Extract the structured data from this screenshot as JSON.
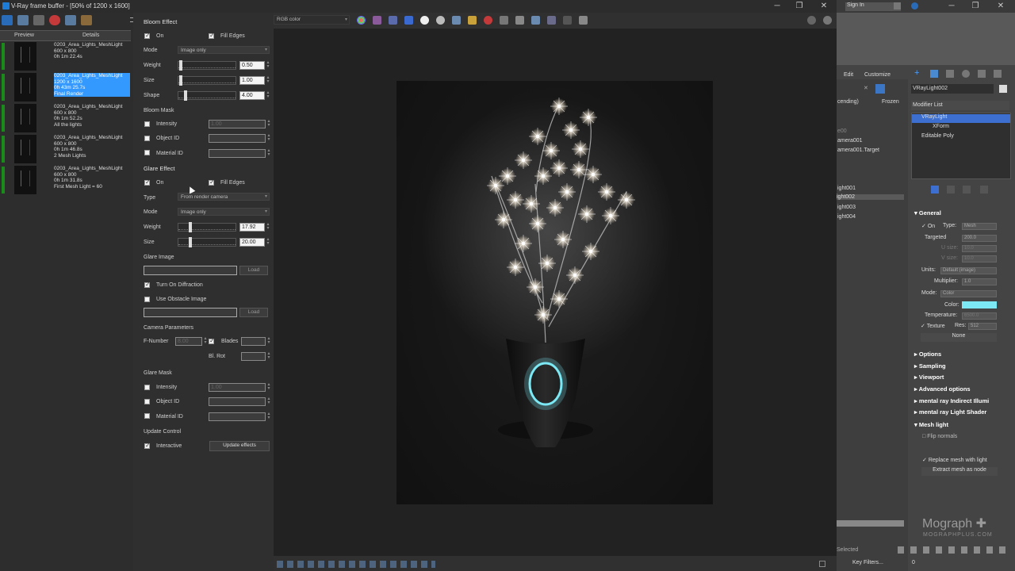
{
  "window": {
    "title": "V-Ray frame buffer - [50% of 1200 x 1600]"
  },
  "history": {
    "tabs": [
      "Preview",
      "Details"
    ],
    "items": [
      {
        "lines": [
          "0203_Area_Lights_MeshLight",
          "600 x 800",
          "0h 1m 22.4s",
          ""
        ],
        "selected": false,
        "flag": "#1a8a1a"
      },
      {
        "lines": [
          "0203_Area_Lights_MeshLight",
          "1200 x 1600",
          "0h 43m 25.7s",
          "Final Render"
        ],
        "selected": true,
        "flag": "#1a8a1a"
      },
      {
        "lines": [
          "0203_Area_Lights_MeshLight",
          "600 x 800",
          "0h 1m 52.2s",
          "All the lights"
        ],
        "selected": false,
        "flag": "#1a8a1a"
      },
      {
        "lines": [
          "0203_Area_Lights_MeshLight",
          "600 x 800",
          "0h 1m 46.8s",
          "2 Mesh Lights"
        ],
        "selected": false,
        "flag": "#1a8a1a"
      },
      {
        "lines": [
          "0203_Area_Lights_MeshLight",
          "600 x 800",
          "0h 1m 31.8s",
          "First Mesh Light = 60"
        ],
        "selected": false,
        "flag": "#1a8a1a"
      }
    ]
  },
  "bloom": {
    "header": "Bloom Effect",
    "on_label": "On",
    "fill_edges_label": "Fill Edges",
    "mode_label": "Mode",
    "mode_value": "Image only",
    "weight_label": "Weight",
    "weight_value": "0.50",
    "size_label": "Size",
    "size_value": "1.00",
    "shape_label": "Shape",
    "shape_value": "4.00",
    "mask_header": "Bloom Mask",
    "intensity_label": "Intensity",
    "intensity_value": "1.00",
    "object_id_label": "Object ID",
    "material_id_label": "Material ID"
  },
  "glare": {
    "header": "Glare Effect",
    "on_label": "On",
    "fill_edges_label": "Fill Edges",
    "type_label": "Type",
    "type_value": "From render camera",
    "mode_label": "Mode",
    "mode_value": "Image only",
    "weight_label": "Weight",
    "weight_value": "17.92",
    "size_label": "Size",
    "size_value": "20.00",
    "image_label": "Glare Image",
    "load_label": "Load",
    "diffraction_label": "Turn On Diffraction",
    "obstacle_label": "Use Obstacle Image",
    "camera_header": "Camera Parameters",
    "fnumber_label": "F-Number",
    "fnumber_value": "8.00",
    "blades_label": "Blades",
    "blrot_label": "Bl. Rot",
    "mask_header": "Glare Mask",
    "intensity_label": "Intensity",
    "intensity_value": "1.00",
    "object_id_label": "Object ID",
    "material_id_label": "Material ID"
  },
  "update": {
    "header": "Update Control",
    "interactive_label": "Interactive",
    "button_label": "Update effects"
  },
  "canvas_toolbar": {
    "channel": "RGB color"
  },
  "max": {
    "signin": "Sign In",
    "menu": [
      "Edit",
      "Customize"
    ],
    "scene_fragments": [
      "cending)",
      "Frozen",
      "e00",
      "amera001",
      "amera001.Target",
      "ight001",
      "ight002",
      "ight003",
      "ight004"
    ],
    "object_name": "VRayLight002",
    "modifier_list": "Modifier List",
    "stack": [
      "VRayLight",
      "XForm",
      "Editable Poly"
    ],
    "general": {
      "header": "General",
      "on_label": "On",
      "type_label": "Type:",
      "type_value": "Mesh",
      "targeted_label": "Targeted",
      "targeted_value": "200.0",
      "usize_label": "U size:",
      "usize_value": "10.0",
      "vsize_label": "V size:",
      "vsize_value": "10.0",
      "units_label": "Units:",
      "units_value": "Default (image)",
      "multiplier_label": "Multiplier:",
      "multiplier_value": "1.0",
      "mode_label": "Mode:",
      "mode_value": "Color",
      "color_label": "Color:",
      "color_value": "#7be8f4",
      "temperature_label": "Temperature:",
      "temperature_value": "6500.0",
      "texture_label": "Texture",
      "res_label": "Res:",
      "res_value": "512",
      "none_label": "None"
    },
    "rollouts": [
      "Options",
      "Sampling",
      "Viewport",
      "Advanced options",
      "mental ray Indirect Illumi",
      "mental ray Light Shader"
    ],
    "mesh_light": {
      "header": "Mesh light",
      "flip_label": "Flip normals",
      "replace_label": "Replace mesh with light",
      "extract_label": "Extract mesh as node"
    },
    "watermark": {
      "brand": "Mograph",
      "url": "MOGRAPHPLUS.COM"
    },
    "bottom": {
      "selected": "Selected",
      "key_filters": "Key Filters...",
      "frame": "0"
    }
  }
}
